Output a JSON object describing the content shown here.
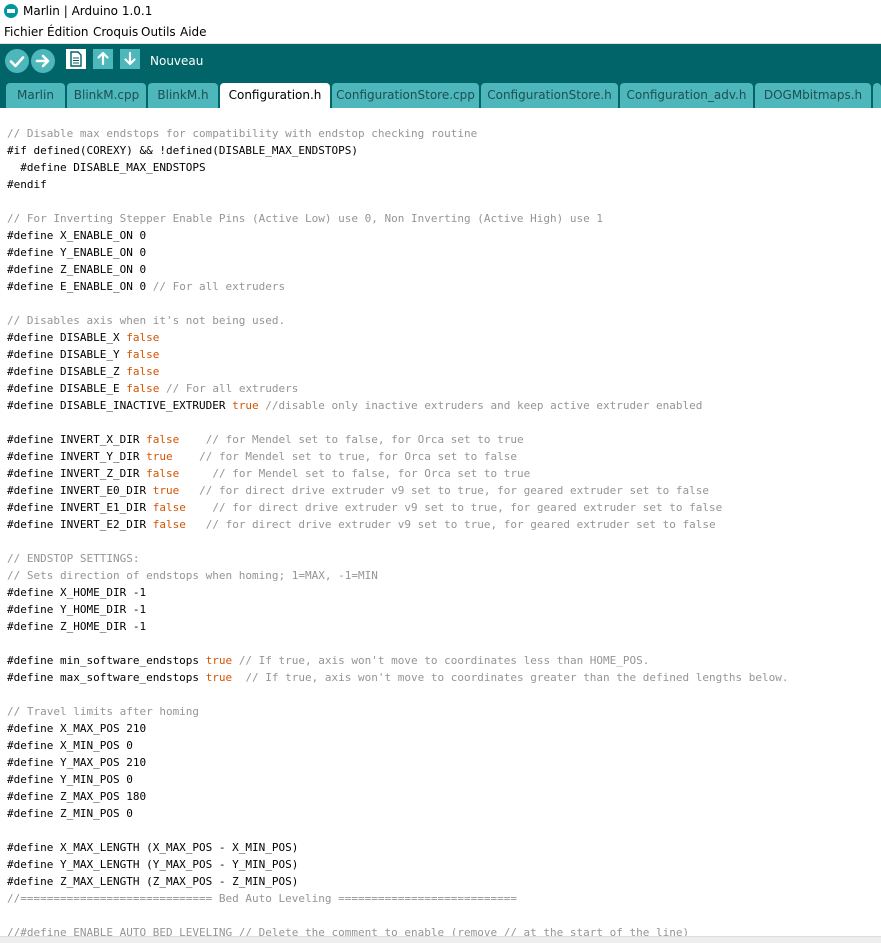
{
  "window": {
    "title": "Marlin | Arduino 1.0.1"
  },
  "menu": [
    "Fichier",
    "Édition",
    "Croquis",
    "Outils",
    "Aide"
  ],
  "toolbar": {
    "label": "Nouveau"
  },
  "tabs": [
    "Marlin",
    "BlinkM.cpp",
    "BlinkM.h",
    "Configuration.h",
    "ConfigurationStore.cpp",
    "ConfigurationStore.h",
    "Configuration_adv.h",
    "DOGMbitmaps.h"
  ],
  "active_tab": "Configuration.h",
  "colors": {
    "toolbar": "#006468",
    "tab": "#4db7bb",
    "keyword": "#d35400",
    "comment": "#959595"
  },
  "code": [
    [
      {
        "t": "// Disable max endstops for compatibility with endstop checking routine",
        "c": "c"
      }
    ],
    [
      {
        "t": "#if defined(COREXY) && !defined(DISABLE_MAX_ENDSTOPS)"
      }
    ],
    [
      {
        "t": "  #define DISABLE_MAX_ENDSTOPS"
      }
    ],
    [
      {
        "t": "#endif"
      }
    ],
    [],
    [
      {
        "t": "// For Inverting Stepper Enable Pins (Active Low) use 0, Non Inverting (Active High) use 1",
        "c": "c"
      }
    ],
    [
      {
        "t": "#define X_ENABLE_ON 0"
      }
    ],
    [
      {
        "t": "#define Y_ENABLE_ON 0"
      }
    ],
    [
      {
        "t": "#define Z_ENABLE_ON 0"
      }
    ],
    [
      {
        "t": "#define E_ENABLE_ON 0 "
      },
      {
        "t": "// For all extruders",
        "c": "c"
      }
    ],
    [],
    [
      {
        "t": "// Disables axis when it's not being used.",
        "c": "c"
      }
    ],
    [
      {
        "t": "#define DISABLE_X "
      },
      {
        "t": "false",
        "c": "k"
      }
    ],
    [
      {
        "t": "#define DISABLE_Y "
      },
      {
        "t": "false",
        "c": "k"
      }
    ],
    [
      {
        "t": "#define DISABLE_Z "
      },
      {
        "t": "false",
        "c": "k"
      }
    ],
    [
      {
        "t": "#define DISABLE_E "
      },
      {
        "t": "false",
        "c": "k"
      },
      {
        "t": " "
      },
      {
        "t": "// For all extruders",
        "c": "c"
      }
    ],
    [
      {
        "t": "#define DISABLE_INACTIVE_EXTRUDER "
      },
      {
        "t": "true",
        "c": "k"
      },
      {
        "t": " "
      },
      {
        "t": "//disable only inactive extruders and keep active extruder enabled",
        "c": "c"
      }
    ],
    [],
    [
      {
        "t": "#define INVERT_X_DIR "
      },
      {
        "t": "false",
        "c": "k"
      },
      {
        "t": "    "
      },
      {
        "t": "// for Mendel set to false, for Orca set to true",
        "c": "c"
      }
    ],
    [
      {
        "t": "#define INVERT_Y_DIR "
      },
      {
        "t": "true",
        "c": "k"
      },
      {
        "t": "    "
      },
      {
        "t": "// for Mendel set to true, for Orca set to false",
        "c": "c"
      }
    ],
    [
      {
        "t": "#define INVERT_Z_DIR "
      },
      {
        "t": "false",
        "c": "k"
      },
      {
        "t": "     "
      },
      {
        "t": "// for Mendel set to false, for Orca set to true",
        "c": "c"
      }
    ],
    [
      {
        "t": "#define INVERT_E0_DIR "
      },
      {
        "t": "true",
        "c": "k"
      },
      {
        "t": "   "
      },
      {
        "t": "// for direct drive extruder v9 set to true, for geared extruder set to false",
        "c": "c"
      }
    ],
    [
      {
        "t": "#define INVERT_E1_DIR "
      },
      {
        "t": "false",
        "c": "k"
      },
      {
        "t": "    "
      },
      {
        "t": "// for direct drive extruder v9 set to true, for geared extruder set to false",
        "c": "c"
      }
    ],
    [
      {
        "t": "#define INVERT_E2_DIR "
      },
      {
        "t": "false",
        "c": "k"
      },
      {
        "t": "   "
      },
      {
        "t": "// for direct drive extruder v9 set to true, for geared extruder set to false",
        "c": "c"
      }
    ],
    [],
    [
      {
        "t": "// ENDSTOP SETTINGS:",
        "c": "c"
      }
    ],
    [
      {
        "t": "// Sets direction of endstops when homing; 1=MAX, -1=MIN",
        "c": "c"
      }
    ],
    [
      {
        "t": "#define X_HOME_DIR -1"
      }
    ],
    [
      {
        "t": "#define Y_HOME_DIR -1"
      }
    ],
    [
      {
        "t": "#define Z_HOME_DIR -1"
      }
    ],
    [],
    [
      {
        "t": "#define min_software_endstops "
      },
      {
        "t": "true",
        "c": "k"
      },
      {
        "t": " "
      },
      {
        "t": "// If true, axis won't move to coordinates less than HOME_POS.",
        "c": "c"
      }
    ],
    [
      {
        "t": "#define max_software_endstops "
      },
      {
        "t": "true",
        "c": "k"
      },
      {
        "t": "  "
      },
      {
        "t": "// If true, axis won't move to coordinates greater than the defined lengths below.",
        "c": "c"
      }
    ],
    [],
    [
      {
        "t": "// Travel limits after homing",
        "c": "c"
      }
    ],
    [
      {
        "t": "#define X_MAX_POS 210"
      }
    ],
    [
      {
        "t": "#define X_MIN_POS 0"
      }
    ],
    [
      {
        "t": "#define Y_MAX_POS 210"
      }
    ],
    [
      {
        "t": "#define Y_MIN_POS 0"
      }
    ],
    [
      {
        "t": "#define Z_MAX_POS 180"
      }
    ],
    [
      {
        "t": "#define Z_MIN_POS 0"
      }
    ],
    [],
    [
      {
        "t": "#define X_MAX_LENGTH (X_MAX_POS - X_MIN_POS)"
      }
    ],
    [
      {
        "t": "#define Y_MAX_LENGTH (Y_MAX_POS - Y_MIN_POS)"
      }
    ],
    [
      {
        "t": "#define Z_MAX_LENGTH (Z_MAX_POS - Z_MIN_POS)"
      }
    ],
    [
      {
        "t": "//============================= Bed Auto Leveling ===========================",
        "c": "c"
      }
    ],
    [],
    [
      {
        "t": "//#define ENABLE_AUTO_BED_LEVELING // Delete the comment to enable (remove // at the start of the line)",
        "c": "c"
      }
    ]
  ]
}
